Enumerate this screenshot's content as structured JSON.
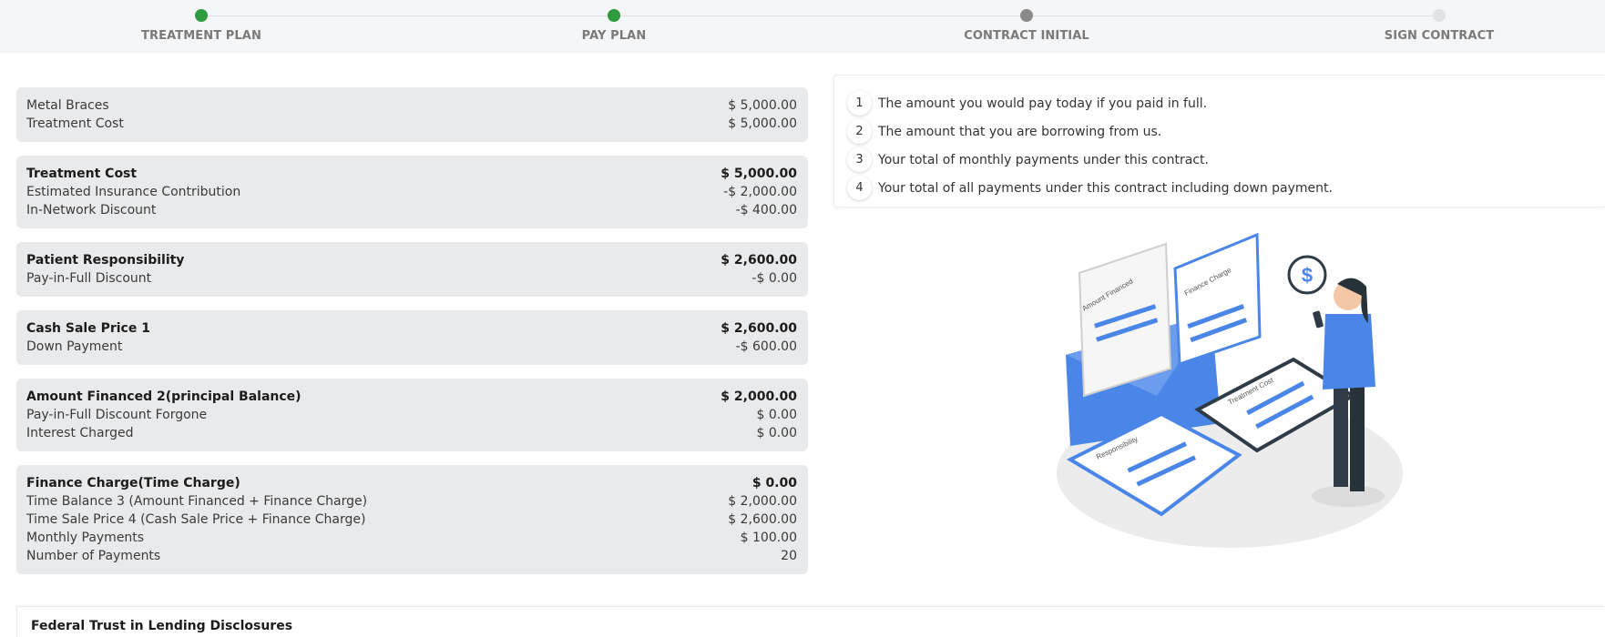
{
  "stepper": {
    "steps": [
      {
        "label": "TREATMENT PLAN",
        "status": "complete",
        "color": "#2e9b3e"
      },
      {
        "label": "PAY PLAN",
        "status": "complete",
        "color": "#2e9b3e"
      },
      {
        "label": "CONTRACT INITIAL",
        "status": "current",
        "color": "#8a8a8a"
      },
      {
        "label": "SIGN CONTRACT",
        "status": "upcoming",
        "color": "#e1e2e5"
      }
    ]
  },
  "summary": {
    "blocks": [
      {
        "rows": [
          {
            "label": "Metal Braces",
            "value": "$ 5,000.00",
            "bold": false
          },
          {
            "label": "Treatment Cost",
            "value": "$ 5,000.00",
            "bold": false
          }
        ]
      },
      {
        "rows": [
          {
            "label": "Treatment Cost",
            "value": "$ 5,000.00",
            "bold": true
          },
          {
            "label": "Estimated Insurance Contribution",
            "value": "-$ 2,000.00",
            "bold": false
          },
          {
            "label": "In-Network Discount",
            "value": "-$ 400.00",
            "bold": false
          }
        ]
      },
      {
        "rows": [
          {
            "label": "Patient Responsibility",
            "value": "$ 2,600.00",
            "bold": true
          },
          {
            "label": "Pay-in-Full Discount",
            "value": "-$ 0.00",
            "bold": false
          }
        ]
      },
      {
        "rows": [
          {
            "label": "Cash Sale Price 1",
            "value": "$ 2,600.00",
            "bold": true
          },
          {
            "label": "Down Payment",
            "value": "-$ 600.00",
            "bold": false
          }
        ]
      },
      {
        "rows": [
          {
            "label": "Amount Financed 2(principal Balance)",
            "value": "$ 2,000.00",
            "bold": true
          },
          {
            "label": "Pay-in-Full Discount Forgone",
            "value": "$ 0.00",
            "bold": false
          },
          {
            "label": "Interest Charged",
            "value": "$ 0.00",
            "bold": false
          }
        ]
      },
      {
        "rows": [
          {
            "label": "Finance Charge(Time Charge)",
            "value": "$ 0.00",
            "bold": true
          },
          {
            "label": "Time Balance 3 (Amount Financed + Finance Charge)",
            "value": "$ 2,000.00",
            "bold": false
          },
          {
            "label": "Time Sale Price 4 (Cash Sale Price + Finance Charge)",
            "value": "$ 2,600.00",
            "bold": false
          },
          {
            "label": "Monthly Payments",
            "value": "$ 100.00",
            "bold": false
          },
          {
            "label": "Number of Payments",
            "value": "20",
            "bold": false
          }
        ]
      }
    ]
  },
  "legend": {
    "items": [
      {
        "num": "1",
        "text": "The amount you would pay today if you paid in full."
      },
      {
        "num": "2",
        "text": "The amount that you are borrowing from us."
      },
      {
        "num": "3",
        "text": "Your total of monthly payments under this contract."
      },
      {
        "num": "4",
        "text": "Your total of all payments under this contract including down payment."
      }
    ]
  },
  "illustration": {
    "doc_labels": [
      "Amount Financed",
      "Finance Charge",
      "Treatment Cost",
      "Responsibility"
    ],
    "icon": "dollar-speech-bubble-icon",
    "accent": "#4a86e8"
  },
  "federal": {
    "title": "Federal Trust in Lending Disclosures"
  }
}
